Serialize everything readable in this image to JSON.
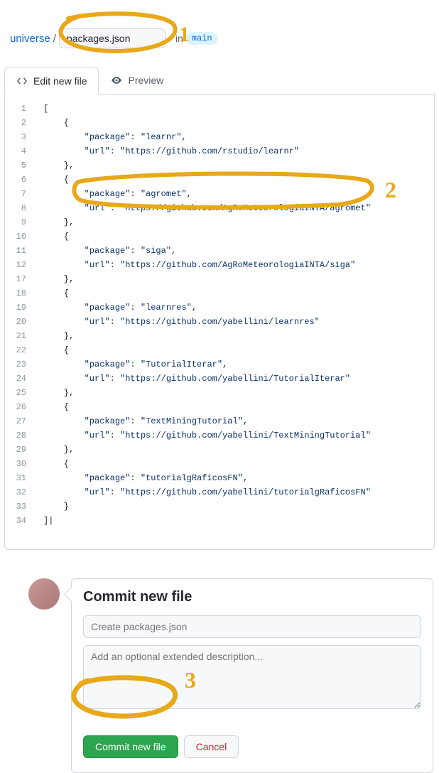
{
  "breadcrumb": {
    "repo": "universe",
    "sep": "/",
    "filename": "packages.json",
    "in_label": "in",
    "branch": "main"
  },
  "tabs": {
    "edit": "Edit new file",
    "preview": "Preview"
  },
  "editor": {
    "line_numbers": [
      "1",
      "2",
      "3",
      "4",
      "5",
      "6",
      "7",
      "8",
      "9",
      "10",
      "11",
      "12",
      "17",
      "18",
      "19",
      "20",
      "21",
      "22",
      "23",
      "24",
      "25",
      "26",
      "27",
      "28",
      "29",
      "30",
      "31",
      "32",
      "33",
      "34"
    ],
    "lines_plain": [
      "[",
      "    {",
      "        \"package\": \"learnr\",",
      "        \"url\": \"https://github.com/rstudio/learnr\"",
      "    },",
      "    {",
      "        \"package\": \"agromet\",",
      "        \"url\": \"https://github.com/AgRoMeteorologiaINTA/agromet\"",
      "    },",
      "    {",
      "        \"package\": \"siga\",",
      "        \"url\": \"https://github.com/AgRoMeteorologiaINTA/siga\"",
      "    },",
      "    {",
      "        \"package\": \"learnres\",",
      "        \"url\": \"https://github.com/yabellini/learnres\"",
      "    },",
      "    {",
      "        \"package\": \"TutorialIterar\",",
      "        \"url\": \"https://github.com/yabellini/TutorialIterar\"",
      "    },",
      "    {",
      "        \"package\": \"TextMiningTutorial\",",
      "        \"url\": \"https://github.com/yabellini/TextMiningTutorial\"",
      "    },",
      "    {",
      "        \"package\": \"tutorialgRaficosFN\",",
      "        \"url\": \"https://github.com/yabellini/tutorialgRaficosFN\"",
      "    }",
      "]|"
    ]
  },
  "commit": {
    "heading": "Commit new file",
    "summary_placeholder": "Create packages.json",
    "desc_placeholder": "Add an optional extended description...",
    "commit_btn": "Commit new file",
    "cancel_btn": "Cancel"
  },
  "annotations": {
    "label1": "1",
    "label2": "2",
    "label3": "3"
  }
}
